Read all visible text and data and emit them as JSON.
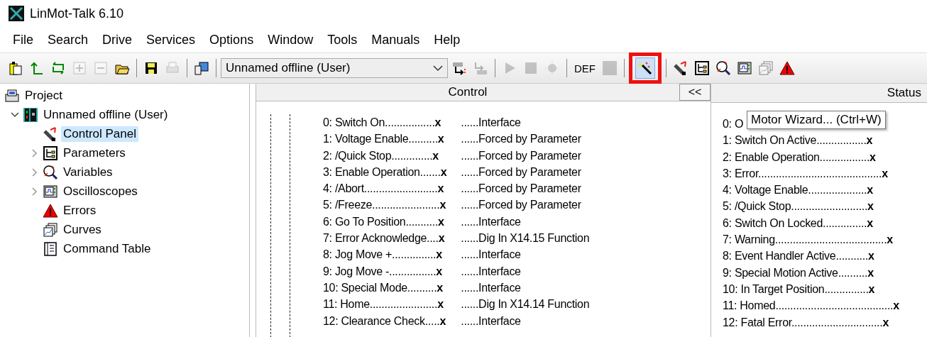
{
  "window": {
    "title": "LinMot-Talk 6.10"
  },
  "menu": [
    "File",
    "Search",
    "Drive",
    "Services",
    "Options",
    "Window",
    "Tools",
    "Manuals",
    "Help"
  ],
  "toolbar": {
    "groups": [
      [
        {
          "kind": "new",
          "disabled": false,
          "highlighted": false
        },
        {
          "kind": "up",
          "disabled": false,
          "highlighted": false
        },
        {
          "kind": "sync",
          "disabled": false,
          "highlighted": false
        },
        {
          "kind": "add",
          "disabled": true,
          "highlighted": false
        },
        {
          "kind": "remove",
          "disabled": true,
          "highlighted": false
        },
        {
          "kind": "open",
          "disabled": false,
          "highlighted": false
        }
      ],
      [
        {
          "kind": "save",
          "disabled": false,
          "highlighted": false
        },
        {
          "kind": "print",
          "disabled": true,
          "highlighted": false
        }
      ],
      [
        {
          "kind": "drive",
          "disabled": false,
          "highlighted": false
        }
      ],
      [
        {
          "kind": "select",
          "value": "Unnamed offline (User)"
        },
        {
          "kind": "send",
          "disabled": false,
          "highlighted": false
        },
        {
          "kind": "receive",
          "disabled": true,
          "highlighted": false
        }
      ],
      [
        {
          "kind": "play",
          "disabled": true,
          "highlighted": false
        },
        {
          "kind": "stop",
          "disabled": true,
          "highlighted": false
        },
        {
          "kind": "home",
          "disabled": true,
          "highlighted": false
        }
      ],
      [
        {
          "kind": "text",
          "label": "DEF",
          "disabled": false,
          "highlighted": false
        },
        {
          "kind": "square",
          "disabled": true,
          "highlighted": false
        }
      ],
      [
        {
          "kind": "wizard",
          "disabled": false,
          "highlighted": true
        }
      ],
      [
        {
          "kind": "panel",
          "disabled": false,
          "highlighted": false
        },
        {
          "kind": "params",
          "disabled": false,
          "highlighted": false
        },
        {
          "kind": "variables",
          "disabled": false,
          "highlighted": false
        },
        {
          "kind": "scope",
          "disabled": false,
          "highlighted": false
        },
        {
          "kind": "curves",
          "disabled": true,
          "highlighted": false
        },
        {
          "kind": "errors",
          "disabled": false,
          "highlighted": false
        }
      ]
    ]
  },
  "tree": {
    "label": "Project",
    "kind": "project",
    "children": [
      {
        "label": "Unnamed offline (User)",
        "kind": "drive",
        "expanded": true,
        "selected": false,
        "children": [
          {
            "label": "Control Panel",
            "kind": "panel",
            "expanded": false,
            "collapsible": false,
            "selected": true
          },
          {
            "label": "Parameters",
            "kind": "params",
            "expanded": false,
            "collapsible": true,
            "selected": false
          },
          {
            "label": "Variables",
            "kind": "variables",
            "expanded": false,
            "collapsible": true,
            "selected": false
          },
          {
            "label": "Oscilloscopes",
            "kind": "scope",
            "expanded": false,
            "collapsible": true,
            "selected": false
          },
          {
            "label": "Errors",
            "kind": "errors",
            "expanded": false,
            "collapsible": false,
            "selected": false
          },
          {
            "label": "Curves",
            "kind": "curves",
            "expanded": false,
            "collapsible": false,
            "selected": false
          },
          {
            "label": "Command Table",
            "kind": "table",
            "expanded": false,
            "collapsible": false,
            "selected": false
          }
        ]
      }
    ]
  },
  "control": {
    "title": "Control",
    "collapse_button": "<<",
    "rows": [
      {
        "label": "0: Switch On.................",
        "value": "x",
        "source": "......Interface"
      },
      {
        "label": "1: Voltage Enable..........",
        "value": "x",
        "source": "......Forced by Parameter"
      },
      {
        "label": "2: /Quick Stop..............",
        "value": "x",
        "source": "......Forced by Parameter"
      },
      {
        "label": "3: Enable Operation.......",
        "value": "x",
        "source": "......Forced by Parameter"
      },
      {
        "label": "4: /Abort.........................",
        "value": "x",
        "source": "......Forced by Parameter"
      },
      {
        "label": "5: /Freeze.......................",
        "value": "x",
        "source": "......Forced by Parameter"
      },
      {
        "label": "6: Go To Position...........",
        "value": "x",
        "source": "......Interface"
      },
      {
        "label": "7: Error Acknowledge....",
        "value": "x",
        "source": "......Dig In X14.15 Function"
      },
      {
        "label": "8: Jog Move +...............",
        "value": "x",
        "source": "......Interface"
      },
      {
        "label": "9: Jog Move -................",
        "value": "x",
        "source": "......Interface"
      },
      {
        "label": "10: Special Mode..........",
        "value": "x",
        "source": "......Interface"
      },
      {
        "label": "11: Home.......................",
        "value": "x",
        "source": "......Dig In X14.14 Function"
      },
      {
        "label": "12: Clearance Check.....",
        "value": "x",
        "source": "......Interface"
      }
    ]
  },
  "status": {
    "title": "Status",
    "rows": [
      {
        "label": "0: O"
      },
      {
        "label": "1: Switch On Active.................",
        "value": "x"
      },
      {
        "label": "2: Enable Operation.................",
        "value": "x"
      },
      {
        "label": "3: Error..........................................",
        "value": "x"
      },
      {
        "label": "4: Voltage Enable....................",
        "value": "x"
      },
      {
        "label": "5: /Quick Stop..........................",
        "value": "x"
      },
      {
        "label": "6: Switch On Locked...............",
        "value": "x"
      },
      {
        "label": "7: Warning......................................",
        "value": "x"
      },
      {
        "label": "8: Event Handler Active...........",
        "value": "x"
      },
      {
        "label": "9: Special Motion Active..........",
        "value": "x"
      },
      {
        "label": "10: In Target Position...............",
        "value": "x"
      },
      {
        "label": "11: Homed........................................",
        "value": "x"
      },
      {
        "label": "12: Fatal Error...............................",
        "value": "x"
      }
    ]
  },
  "tooltip": "Motor Wizard... (Ctrl+W)"
}
